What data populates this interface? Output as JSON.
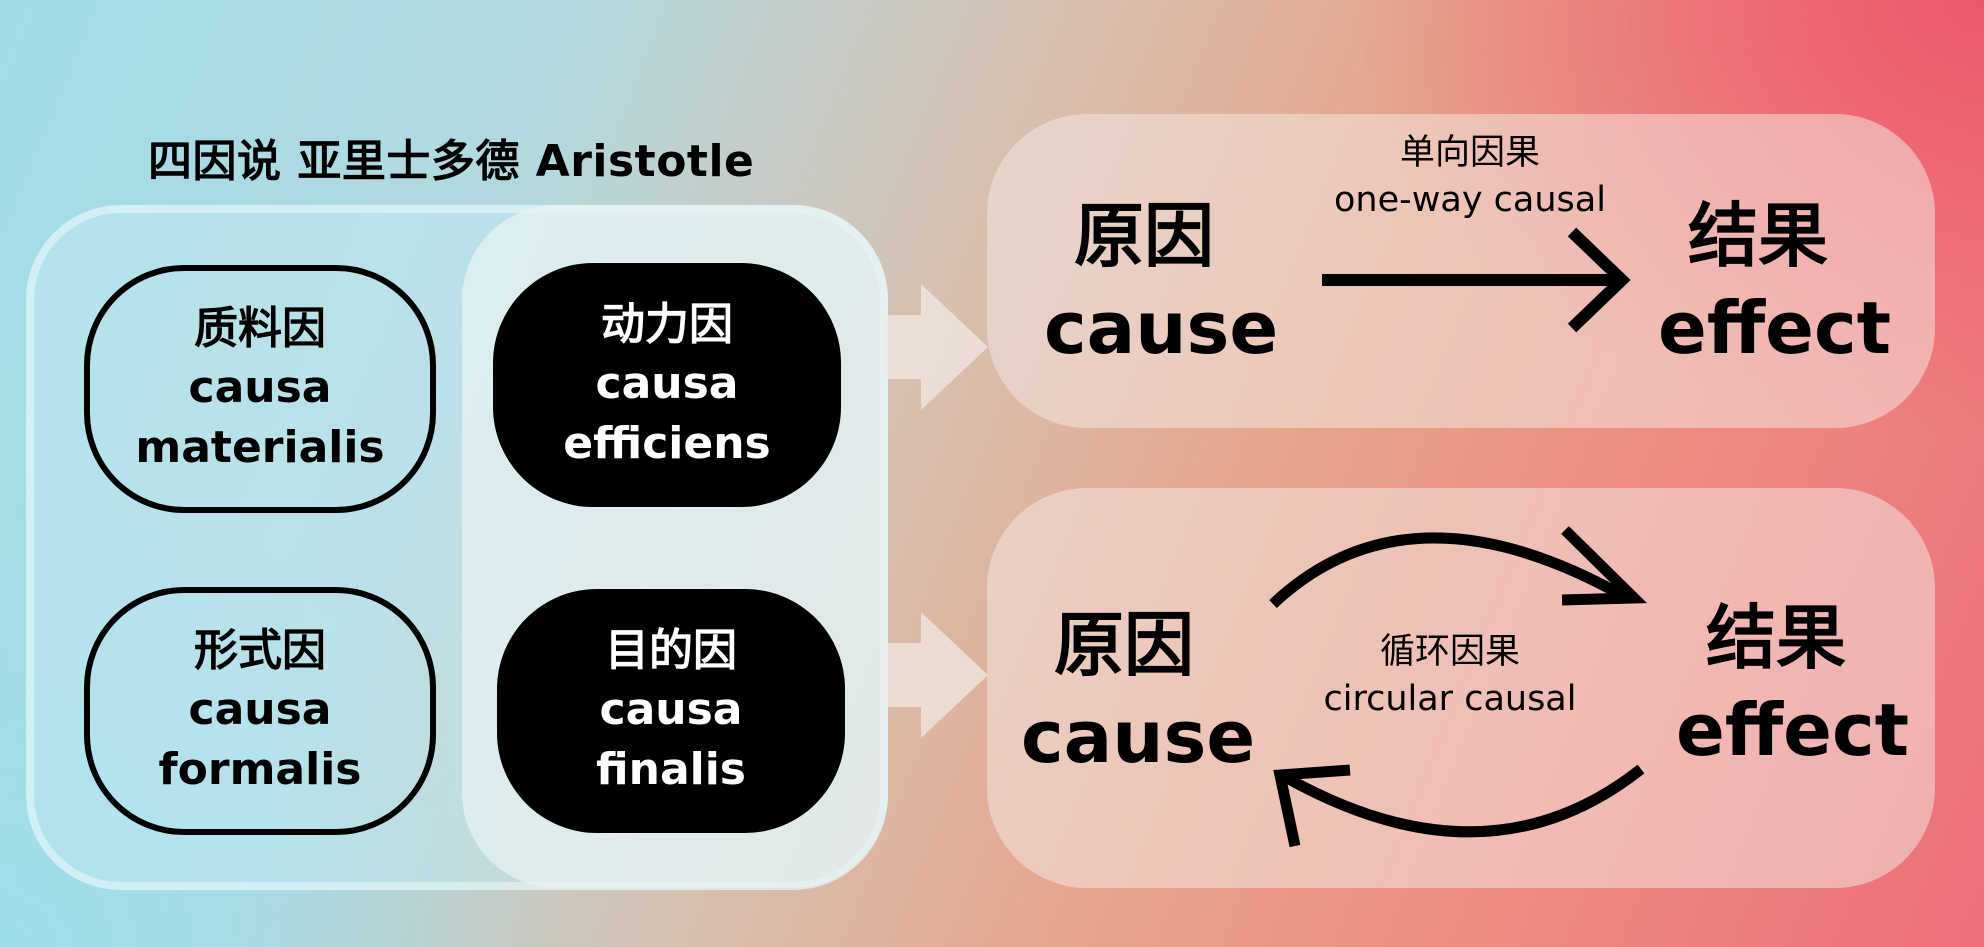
{
  "heading": "四因说   亚里士多德 Aristotle",
  "causes": {
    "material": {
      "zh": "质料因",
      "line1": "causa",
      "line2": "materialis"
    },
    "efficient": {
      "zh": "动力因",
      "line1": "causa",
      "line2": "efficiens"
    },
    "formal": {
      "zh": "形式因",
      "line1": "causa",
      "line2": "formalis"
    },
    "final": {
      "zh": "目的因",
      "line1": "causa",
      "line2": "finalis"
    }
  },
  "one_way": {
    "cause_zh": "原因",
    "cause_en": "cause",
    "label_zh": "单向因果",
    "label_en": "one-way causal",
    "effect_zh": "结果",
    "effect_en": "effect"
  },
  "circular": {
    "cause_zh": "原因",
    "cause_en": "cause",
    "label_zh": "循环因果",
    "label_en": "circular causal",
    "effect_zh": "结果",
    "effect_en": "effect"
  }
}
